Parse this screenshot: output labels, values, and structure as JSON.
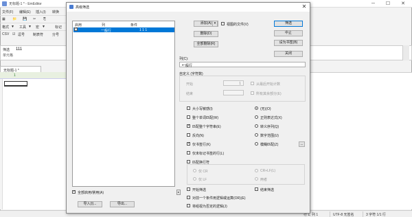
{
  "window": {
    "title": "无标题-1 * - EmEditor",
    "controls": "─ ☐ ✕"
  },
  "menubar": [
    "文件(F)",
    "编辑(E)",
    "插入(I)",
    "转换"
  ],
  "toolbar_rows": [
    [
      "▦",
      "📁",
      "💾",
      "✂",
      "⎘"
    ],
    [
      "格式",
      "▼",
      "工具",
      "▼",
      "宏",
      "▼",
      "标记"
    ],
    [
      "CSV",
      "☑",
      "逗号",
      "制表符",
      "分号"
    ]
  ],
  "search_bar": {
    "label": "筛选",
    "value": "111",
    "hint": "单元格"
  },
  "doc_tab": {
    "label": "无标题-1 *"
  },
  "ruler": {
    "col": "1"
  },
  "statusbar": {
    "pos": "行 1, 列 1",
    "encoding": "UTF-8 无签名",
    "count": "3 字符 1/1 行"
  },
  "dialog": {
    "title": "高级筛选",
    "list": {
      "headers": [
        "启用",
        "列",
        "条件"
      ],
      "rows": [
        {
          "enabled": true,
          "column": "一般行",
          "condition": "1 1 1"
        }
      ]
    },
    "enable_all_label": "全部启用/禁用(A)",
    "import_label": "导入(I)...",
    "export_label": "导出...",
    "add_label": "添加(A)",
    "delete_label": "删除(D)",
    "delete_all_label": "全部删除(R)",
    "all_files_label": "视图的文件(V)",
    "filter_label": "筛选",
    "abort_label": "中止",
    "bookmark_label": "设为书签(B)",
    "close_label": "关闭",
    "column_section_label": "列(C):",
    "column_value": "一般行",
    "custom_section": "自定义 (字符数)",
    "start_label": "开始",
    "start_value": "1",
    "end_label": "结束",
    "from_end_label": "从最后开始计数",
    "all_remaining_label": "所有其余部分(E)",
    "options_left": [
      {
        "label": "大小写敏感(I)",
        "checked": false
      },
      {
        "label": "整个单词匹配(W)",
        "checked": false
      },
      {
        "label": "匹配整个字符串(E)",
        "checked": true
      },
      {
        "label": "反向(N)",
        "checked": false
      },
      {
        "label": "仅书签行(K)",
        "checked": true
      },
      {
        "label": "仅未标记书签的行(L)",
        "checked": false
      }
    ],
    "options_right": [
      {
        "label": "(无)(O)",
        "on": true
      },
      {
        "label": "正则表达式(X)",
        "on": false
      },
      {
        "label": "转义序列(Q)",
        "on": false
      },
      {
        "label": "数字范围(U)",
        "on": false
      }
    ],
    "fuzzy_label": "模糊匹配(Z)",
    "more_label": "...",
    "match_linebreak_label": "匹配换行符",
    "cr_label": "仅 CR",
    "crlf_label": "CR+LF(L)",
    "lf_label": "仅 LF",
    "both_label": "两者",
    "begin_filter_label": "开始筛选",
    "end_filter_label": "结束筛选",
    "combine_label": "对前一个条件用逻辑或运算(OR)(E)",
    "negate_label": "将组视为否定的逻辑(J)"
  }
}
